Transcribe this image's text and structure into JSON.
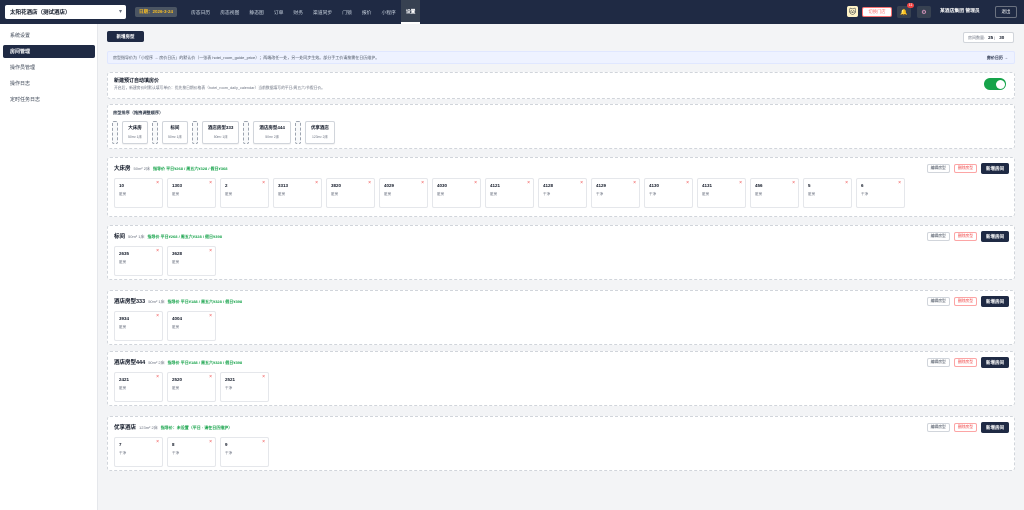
{
  "topbar": {
    "hotel": "太阳花酒店（测试酒店）",
    "date_badge": "日期：2026-3-24",
    "nav": [
      "房态日历",
      "房态视图",
      "静态图",
      "订单",
      "财务",
      "渠道同步",
      "门锁",
      "报价",
      "小程序",
      "设置"
    ],
    "active_nav": "设置",
    "avatar_emoji": "🐱",
    "switch_store": "切换门店",
    "bell_count": "11",
    "user": "某酒店集团 管理员",
    "logout": "退出"
  },
  "sidebar": {
    "items": [
      "系统设置",
      "房间管理",
      "操作员管理",
      "操作日志",
      "定时任务日志"
    ],
    "active": "房间管理"
  },
  "main": {
    "add_type": "新增房型",
    "room_count_label": "房间数量:",
    "room_count_a": "25",
    "room_count_b": "30",
    "info": "房型指导价为「小程序 → 房价日历」的默认价（一张表 hotel_room_guide_price）；两端改任一处，另一处同步生效。部分手工价请按需在日历维护。",
    "info_link": "房价日历 →",
    "auto": {
      "title": "新建预订自动填房价",
      "desc": "开启后，新建房价时默认填写单价：优先按日期价格表（hotel_room_daily_calendar）当前数据填写的平日/周五六/节假日价。"
    },
    "sort": {
      "title": "房型排序（拖拽调整顺序）",
      "chips": [
        {
          "name": "大床房",
          "meta": "50m² 1床"
        },
        {
          "name": "标间",
          "meta": "50m² 1床"
        },
        {
          "name": "酒店房型333",
          "meta": "50m² 1床"
        },
        {
          "name": "酒店房型444",
          "meta": "50m² 2床"
        },
        {
          "name": "优享酒店",
          "meta": "123m² 2床"
        }
      ]
    },
    "btn_edit": "编辑房型",
    "btn_delete": "删除房型",
    "btn_add_room": "新增房间",
    "types": [
      {
        "name": "大床房",
        "meta": "50m² 2床",
        "price": "指导价 平日¥268 / 周五六¥328 / 假日¥368",
        "rooms": [
          [
            "10",
            "脏房"
          ],
          [
            "1303",
            "脏房"
          ],
          [
            "2",
            "脏房"
          ],
          [
            "3313",
            "脏房"
          ],
          [
            "3820",
            "脏房"
          ],
          [
            "4029",
            "脏房"
          ],
          [
            "4030",
            "脏房"
          ],
          [
            "4121",
            "脏房"
          ],
          [
            "4128",
            "干净"
          ],
          [
            "4129",
            "干净"
          ],
          [
            "4130",
            "干净"
          ],
          [
            "4131",
            "脏房"
          ],
          [
            "456",
            "脏房"
          ],
          [
            "5",
            "脏房"
          ],
          [
            "6",
            "干净"
          ]
        ]
      },
      {
        "name": "标间",
        "meta": "50m² 1床",
        "price": "指导价 平日¥268 / 周五六¥328 / 假日¥398",
        "rooms": [
          [
            "2635",
            "脏房"
          ],
          [
            "3628",
            "脏房"
          ]
        ]
      },
      {
        "name": "酒店房型333",
        "meta": "50m² 1床",
        "price": "指导价 平日¥188 / 周五六¥328 / 假日¥398",
        "rooms": [
          [
            "3934",
            "脏房"
          ],
          [
            "4004",
            "脏房"
          ]
        ]
      },
      {
        "name": "酒店房型444",
        "meta": "50m² 2床",
        "price": "指导价 平日¥188 / 周五六¥328 / 假日¥398",
        "rooms": [
          [
            "2421",
            "脏房"
          ],
          [
            "2520",
            "脏房"
          ],
          [
            "2521",
            "干净"
          ]
        ]
      },
      {
        "name": "优享酒店",
        "meta": "123m² 2床",
        "price": "指导价：未设置（平日 · 请在日历维护）",
        "rooms": [
          [
            "7",
            "干净"
          ],
          [
            "8",
            "干净"
          ],
          [
            "9",
            "干净"
          ]
        ]
      }
    ]
  }
}
